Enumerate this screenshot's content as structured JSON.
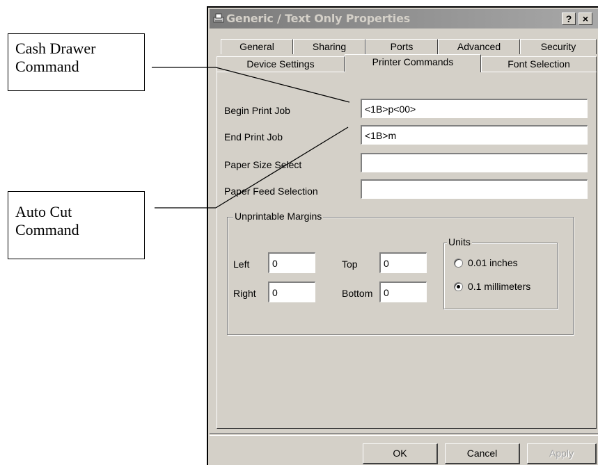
{
  "callouts": {
    "cash_drawer": "Cash Drawer\nCommand",
    "auto_cut": "Auto Cut\nCommand"
  },
  "window": {
    "title": "Generic / Text Only Properties",
    "help_label": "?",
    "close_label": "×"
  },
  "tabs": {
    "back_row": [
      "General",
      "Sharing",
      "Ports",
      "Advanced",
      "Security"
    ],
    "front_row": [
      "Device Settings",
      "Printer Commands",
      "Font Selection"
    ],
    "active": "Printer Commands"
  },
  "commands": {
    "begin_label": "Begin Print Job",
    "begin_value": "<1B>p<00>",
    "end_label": "End Print Job",
    "end_value": "<1B>m",
    "paper_size_label": "Paper Size Select",
    "paper_size_value": "",
    "paper_feed_label": "Paper Feed Selection",
    "paper_feed_value": ""
  },
  "margins": {
    "group_title": "Unprintable Margins",
    "left_label": "Left",
    "left_value": "0",
    "top_label": "Top",
    "top_value": "0",
    "right_label": "Right",
    "right_value": "0",
    "bottom_label": "Bottom",
    "bottom_value": "0"
  },
  "units": {
    "group_title": "Units",
    "option_inches": "0.01 inches",
    "option_mm": "0.1 millimeters",
    "selected": "0.1 millimeters"
  },
  "buttons": {
    "ok": "OK",
    "cancel": "Cancel",
    "apply": "Apply"
  }
}
